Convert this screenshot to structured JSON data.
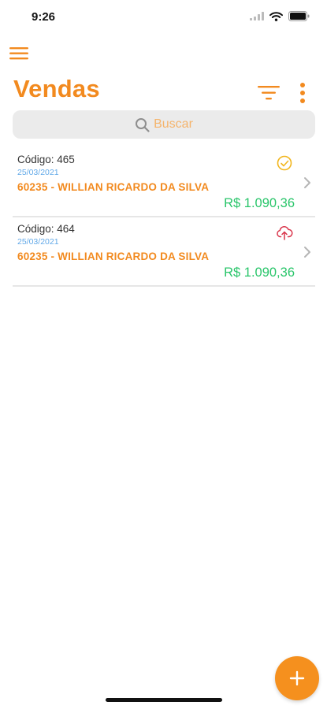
{
  "status_bar": {
    "time": "9:26"
  },
  "header": {
    "title": "Vendas"
  },
  "search": {
    "placeholder": "Buscar"
  },
  "sales": [
    {
      "code": "Código: 465",
      "date": "25/03/2021",
      "client": "60235 - WILLIAN RICARDO DA SILVA",
      "value": "R$ 1.090,36",
      "status_icon": "check-circle-icon"
    },
    {
      "code": "Código: 464",
      "date": "25/03/2021",
      "client": "60235 - WILLIAN RICARDO DA SILVA",
      "value": "R$ 1.090,36",
      "status_icon": "cloud-upload-icon"
    }
  ],
  "colors": {
    "accent": "#F28A1F",
    "date": "#62A9E8",
    "value": "#29C56A",
    "synced": "#F2B61E",
    "pending_upload": "#D9344A"
  }
}
